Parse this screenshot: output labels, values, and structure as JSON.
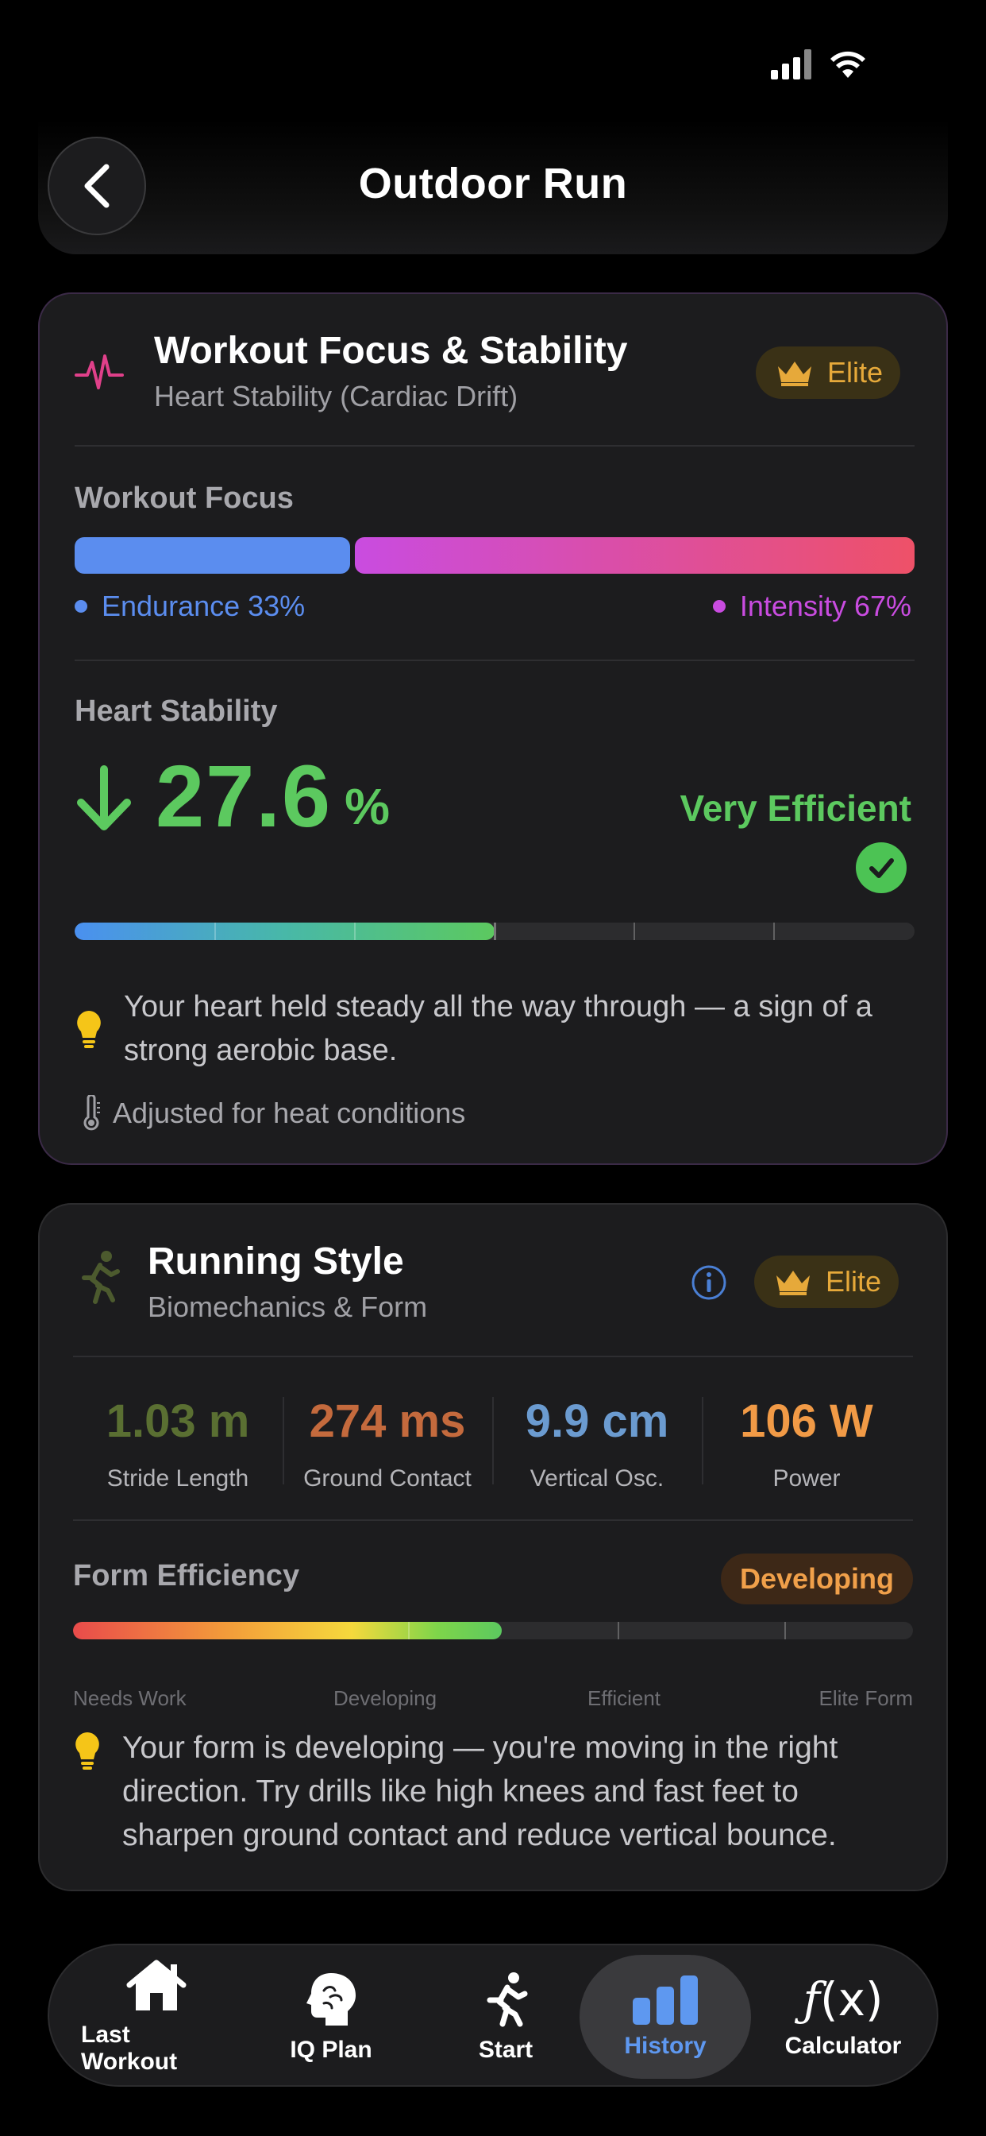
{
  "header": {
    "title": "Outdoor Run",
    "back_icon": "chevron-left-icon"
  },
  "focus_card": {
    "title": "Workout Focus & Stability",
    "subtitle": "Heart Stability (Cardiac Drift)",
    "badge": "Elite",
    "focus_label": "Workout Focus",
    "endurance_label": "Endurance 33%",
    "intensity_label": "Intensity 67%",
    "endurance_pct": 33,
    "intensity_pct": 67,
    "stability_label": "Heart Stability",
    "stability_value": "27.6",
    "stability_unit": "%",
    "stability_rating": "Very Efficient",
    "stability_gauge_pct": 50,
    "tip": "Your heart held steady all the way through — a sign of a strong aerobic base.",
    "heat_note": "Adjusted for heat conditions"
  },
  "running_card": {
    "title": "Running Style",
    "subtitle": "Biomechanics & Form",
    "badge": "Elite",
    "metrics": [
      {
        "value": "1.03 m",
        "label": "Stride Length",
        "color": "#5a6f32"
      },
      {
        "value": "274 ms",
        "label": "Ground Contact",
        "color": "#c46a3d"
      },
      {
        "value": "9.9 cm",
        "label": "Vertical Osc.",
        "color": "#6b9bd0"
      },
      {
        "value": "106 W",
        "label": "Power",
        "color": "#f19a46"
      }
    ],
    "form_label": "Form Efficiency",
    "form_badge": "Developing",
    "form_gauge_pct": 51,
    "scale": [
      "Needs Work",
      "Developing",
      "Efficient",
      "Elite Form"
    ],
    "tip": "Your form is developing — you're moving in the right direction. Try drills like high knees and fast feet to sharpen ground contact and reduce vertical bounce."
  },
  "tabs": [
    {
      "label": "Last Workout",
      "icon": "home-icon"
    },
    {
      "label": "IQ Plan",
      "icon": "brain-icon"
    },
    {
      "label": "Start",
      "icon": "runner-icon"
    },
    {
      "label": "History",
      "icon": "bar-chart-icon",
      "active": true
    },
    {
      "label": "Calculator",
      "icon": "function-icon"
    }
  ],
  "colors": {
    "accent_green": "#5cc95f",
    "endurance_blue": "#5b8def",
    "intensity_magenta": "#c94ce0",
    "elite_gold": "#e6a93a",
    "active_tab_blue": "#5e98f0"
  }
}
